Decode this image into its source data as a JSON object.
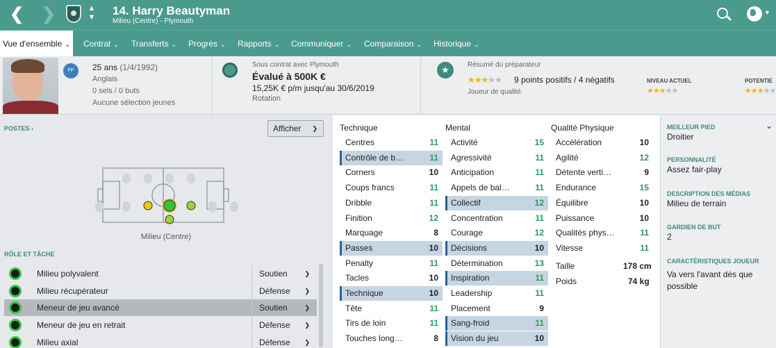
{
  "header": {
    "player_title": "14. Harry Beautyman",
    "player_subtitle": "Milieu (Centre) - Plymouth"
  },
  "tabs": [
    {
      "label": "Vue d'ensemble"
    },
    {
      "label": "Contrat"
    },
    {
      "label": "Transferts"
    },
    {
      "label": "Progrès"
    },
    {
      "label": "Rapports"
    },
    {
      "label": "Communiquer"
    },
    {
      "label": "Comparaison"
    },
    {
      "label": "Historique"
    }
  ],
  "profile": {
    "position_badge": "FP",
    "age": "25 ans",
    "dob": "(1/4/1992)",
    "nationality": "Anglais",
    "caps": "0 sels / 0 buts",
    "youth": "Aucune sélection jeunes"
  },
  "contract": {
    "status": "Sous contrat avec Plymouth",
    "value": "Évalué à 500K €",
    "wage": "15,25K € p/m jusqu'au 30/6/2019",
    "role": "Rotation"
  },
  "scout": {
    "title": "Résumé du préparateur",
    "stars_on": 3,
    "stars_total": 5,
    "summary": "9 points positifs / 4 négatifs",
    "note": "Joueur de qualité.",
    "current_label": "NIVEAU ACTUEL",
    "current_stars": 3,
    "potential_label": "POTENTIE",
    "potential_stars": 3
  },
  "positions": {
    "label": "POSTES",
    "show_button": "Afficher",
    "caption": "Milieu (Centre)"
  },
  "roles": {
    "label": "RÔLE ET TÂCHE",
    "items": [
      {
        "name": "Milieu polyvalent",
        "duty": "Soutien"
      },
      {
        "name": "Milieu récupérateur",
        "duty": "Défense"
      },
      {
        "name": "Meneur de jeu avancé",
        "duty": "Soutien"
      },
      {
        "name": "Meneur de jeu en retrait",
        "duty": "Défense"
      },
      {
        "name": "Milieu axial",
        "duty": "Défense"
      }
    ]
  },
  "attributes": {
    "technique": {
      "title": "Technique",
      "items": [
        {
          "name": "Centres",
          "value": 11
        },
        {
          "name": "Contrôle de b…",
          "value": 11
        },
        {
          "name": "Corners",
          "value": 10
        },
        {
          "name": "Coups francs",
          "value": 11
        },
        {
          "name": "Dribble",
          "value": 11
        },
        {
          "name": "Finition",
          "value": 12
        },
        {
          "name": "Marquage",
          "value": 8
        },
        {
          "name": "Passes",
          "value": 10
        },
        {
          "name": "Penalty",
          "value": 11
        },
        {
          "name": "Tacles",
          "value": 10
        },
        {
          "name": "Technique",
          "value": 10
        },
        {
          "name": "Tête",
          "value": 11
        },
        {
          "name": "Tirs de loin",
          "value": 11
        },
        {
          "name": "Touches long…",
          "value": 8
        }
      ]
    },
    "mental": {
      "title": "Mental",
      "items": [
        {
          "name": "Activité",
          "value": 15
        },
        {
          "name": "Agressivité",
          "value": 11
        },
        {
          "name": "Anticipation",
          "value": 11
        },
        {
          "name": "Appels de bal…",
          "value": 11
        },
        {
          "name": "Collectif",
          "value": 12
        },
        {
          "name": "Concentration",
          "value": 11
        },
        {
          "name": "Courage",
          "value": 12
        },
        {
          "name": "Décisions",
          "value": 10
        },
        {
          "name": "Détermination",
          "value": 13
        },
        {
          "name": "Inspiration",
          "value": 11
        },
        {
          "name": "Leadership",
          "value": 11
        },
        {
          "name": "Placement",
          "value": 9
        },
        {
          "name": "Sang-froid",
          "value": 11
        },
        {
          "name": "Vision du jeu",
          "value": 10
        }
      ]
    },
    "physical": {
      "title": "Qualité Physique",
      "items": [
        {
          "name": "Accélération",
          "value": 10
        },
        {
          "name": "Agilité",
          "value": 12
        },
        {
          "name": "Détente verti…",
          "value": 9
        },
        {
          "name": "Endurance",
          "value": 15
        },
        {
          "name": "Équilibre",
          "value": 10
        },
        {
          "name": "Puissance",
          "value": 10
        },
        {
          "name": "Qualités phys…",
          "value": 11
        },
        {
          "name": "Vitesse",
          "value": 11
        }
      ],
      "height_label": "Taille",
      "height_value": "178 cm",
      "weight_label": "Poids",
      "weight_value": "74 kg"
    }
  },
  "details": {
    "foot_label": "MEILLEUR PIED",
    "foot_value": "Droitier",
    "personality_label": "PERSONNALITÉ",
    "personality_value": "Assez fair-play",
    "media_label": "DESCRIPTION DES MÉDIAS",
    "media_value": "Milieu de terrain",
    "gk_label": "GARDIEN DE BUT",
    "gk_value": "2",
    "traits_label": "CARACTÉRISTIQUES JOUEUR",
    "traits_value": "Va vers l'avant dès que possible"
  },
  "colors": {
    "header": "#4a9a8e",
    "accent_label": "#3f8a7e",
    "value_green": "#2b9a61",
    "highlight_row": "#c6d5e2",
    "star": "#f2b600"
  }
}
